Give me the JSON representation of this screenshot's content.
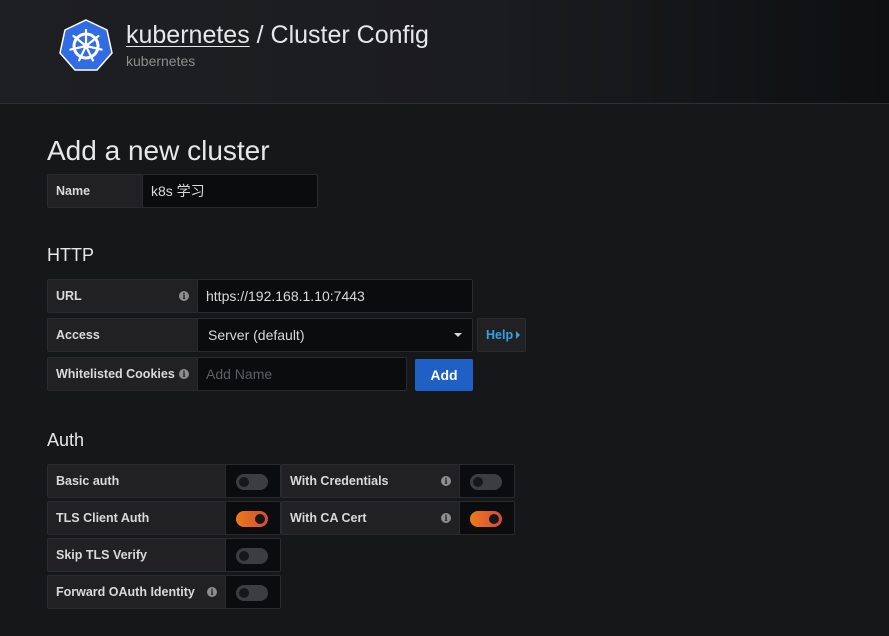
{
  "header": {
    "crumb_link": "kubernetes",
    "separator": " / ",
    "title": "Cluster Config",
    "subtitle": "kubernetes",
    "logo_icon": "kubernetes-helm-wheel-icon",
    "logo_color": "#326ce5"
  },
  "page_title": "Add a new cluster",
  "name_field": {
    "label": "Name",
    "value": "k8s 学习"
  },
  "http": {
    "heading": "HTTP",
    "url_label": "URL",
    "url_value": "https://192.168.1.10:7443",
    "access_label": "Access",
    "access_value": "Server (default)",
    "help_label": "Help",
    "cookies_label": "Whitelisted Cookies",
    "cookies_placeholder": "Add Name",
    "add_button": "Add"
  },
  "auth": {
    "heading": "Auth",
    "toggles": [
      {
        "label": "Basic auth",
        "on": false
      },
      {
        "label": "With Credentials",
        "on": false
      },
      {
        "label": "TLS Client Auth",
        "on": true
      },
      {
        "label": "With CA Cert",
        "on": true
      },
      {
        "label": "Skip TLS Verify",
        "on": false
      },
      {
        "label": "Forward OAuth Identity",
        "on": false
      }
    ]
  },
  "colors": {
    "accent_blue": "#1f60c4",
    "link_blue": "#33a2e5",
    "toggle_on": "#eb7b18"
  }
}
